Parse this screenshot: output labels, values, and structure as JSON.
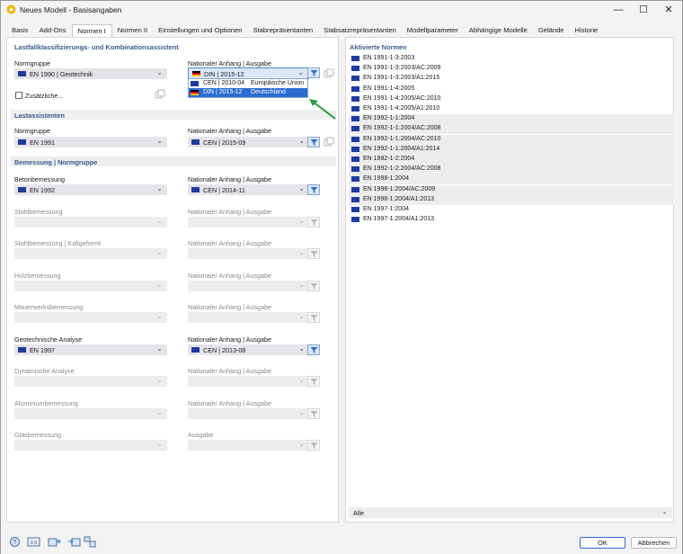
{
  "window": {
    "title": "Neues Modell - Basisangaben",
    "minimize": "—",
    "maximize": "☐",
    "close": "✕"
  },
  "tabs": [
    "Basis",
    "Add-Ons",
    "Normen I",
    "Normen II",
    "Einstellungen und Optionen",
    "Stabrepräsentanten",
    "Stabsatzrepräsentanten",
    "Modellparameter",
    "Abhängige Modelle",
    "Gelände",
    "Historie"
  ],
  "active_tab": "Normen I",
  "left": {
    "load_section_title": "Lastfallklassifizierungs- und Kombinationsassistent",
    "normgruppe_label": "Normgruppe",
    "normgruppe_value": "EN 1990 | Geotechnik",
    "anhang_label": "Nationaler Anhang | Ausgabe",
    "anhang_value": "DIN | 2015-12",
    "zusaetzliche_label": "Zusätzliche...",
    "dropdown": [
      {
        "code": "CEN | 2010-04",
        "desc": "Europäische Union",
        "flag": "eu"
      },
      {
        "code": "DIN | 2015-12",
        "desc": "Deutschland",
        "flag": "de"
      }
    ],
    "lastassistenten_title": "Lastassistenten",
    "la_normgruppe_label": "Normgruppe",
    "la_normgruppe_value": "EN 1991",
    "la_anhang_label": "Nationaler Anhang | Ausgabe",
    "la_anhang_value": "CEN | 2015-09",
    "bemessung_title": "Bemessung | Normgruppe",
    "rows": [
      {
        "label": "Betonbemessung",
        "value": "EN 1992",
        "anhang_label": "Nationaler Anhang | Ausgabe",
        "anhang_value": "CEN | 2014-11",
        "enabled": true
      },
      {
        "label": "Stahlbemessung",
        "value": "",
        "anhang_label": "Nationaler Anhang | Ausgabe",
        "anhang_value": "",
        "enabled": false
      },
      {
        "label": "Stahlbemessung | Kaltgeformt",
        "value": "",
        "anhang_label": "Nationaler Anhang | Ausgabe",
        "anhang_value": "",
        "enabled": false
      },
      {
        "label": "Holzbemessung",
        "value": "",
        "anhang_label": "Nationaler Anhang | Ausgabe",
        "anhang_value": "",
        "enabled": false
      },
      {
        "label": "Mauerwerksbemessung",
        "value": "",
        "anhang_label": "Nationaler Anhang | Ausgabe",
        "anhang_value": "",
        "enabled": false
      },
      {
        "label": "Geotechnische Analyse",
        "value": "EN 1997",
        "anhang_label": "Nationaler Anhang | Ausgabe",
        "anhang_value": "CEN | 2013-08",
        "enabled": true
      },
      {
        "label": "Dynamische Analyse",
        "value": "",
        "anhang_label": "Nationaler Anhang | Ausgabe",
        "anhang_value": "",
        "enabled": false
      },
      {
        "label": "Aluminiumbemessung",
        "value": "",
        "anhang_label": "Nationaler Anhang | Ausgabe",
        "anhang_value": "",
        "enabled": false
      },
      {
        "label": "Glasbemessung",
        "value": "",
        "anhang_label": "Ausgabe",
        "anhang_value": "",
        "enabled": false
      }
    ]
  },
  "right": {
    "title": "Aktivierte Normen",
    "norms": [
      {
        "text": "EN 1991-1-3:2003",
        "shade": false
      },
      {
        "text": "EN 1991-1-3:2003/AC:2009",
        "shade": false
      },
      {
        "text": "EN 1991-1-3:2003/A1:2015",
        "shade": false
      },
      {
        "text": "EN 1991-1-4:2005",
        "shade": false
      },
      {
        "text": "EN 1991-1-4:2005/AC:2010",
        "shade": false
      },
      {
        "text": "EN 1991-1-4:2005/A1:2010",
        "shade": false
      },
      {
        "text": "EN 1992-1-1:2004",
        "shade": true
      },
      {
        "text": "EN 1992-1-1:2004/AC:2008",
        "shade": true
      },
      {
        "text": "EN 1992-1-1:2004/AC:2010",
        "shade": true
      },
      {
        "text": "EN 1992-1-1:2004/A1:2014",
        "shade": true
      },
      {
        "text": "EN 1992-1-2:2004",
        "shade": true
      },
      {
        "text": "EN 1992-1-2:2004/AC:2008",
        "shade": true
      },
      {
        "text": "EN 1998-1:2004",
        "shade": true
      },
      {
        "text": "EN 1998-1:2004/AC:2009",
        "shade": true
      },
      {
        "text": "EN 1998-1:2004/A1:2013",
        "shade": true
      },
      {
        "text": "EN 1997-1:2004",
        "shade": false
      },
      {
        "text": "EN 1997-1:2004/A1:2013",
        "shade": false
      }
    ],
    "filter_value": "Alle"
  },
  "footer": {
    "ok": "OK",
    "cancel": "Abbrechen"
  },
  "colors": {
    "accent": "#2b6dd2",
    "section_title": "#3c5a8c",
    "arrow": "#2e9a3e"
  }
}
